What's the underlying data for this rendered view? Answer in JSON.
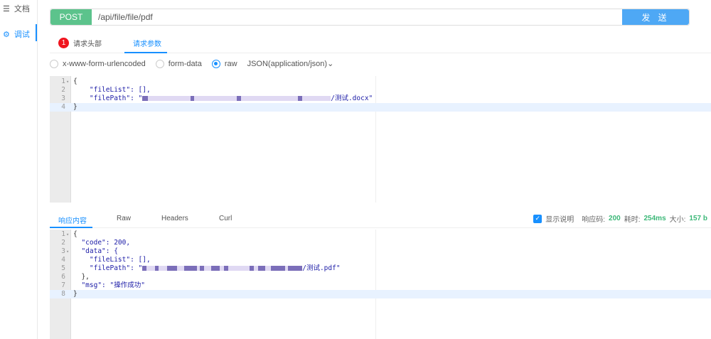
{
  "sidebar": {
    "items": [
      {
        "label": "文档",
        "icon": "doc-icon"
      },
      {
        "label": "调试",
        "icon": "debug-icon",
        "active": true
      }
    ]
  },
  "request": {
    "method": "POST",
    "url": "/api/file/file/pdf",
    "send_label": "发 送"
  },
  "tabs": [
    {
      "label": "请求头部",
      "badge": "1"
    },
    {
      "label": "请求参数",
      "active": true
    }
  ],
  "body_types": {
    "options": [
      "x-www-form-urlencoded",
      "form-data",
      "raw"
    ],
    "selected": "raw",
    "raw_format": "JSON(application/json)"
  },
  "request_body": {
    "lines": [
      "{",
      "    \"fileList\": [],",
      "    \"filePath\": \"",
      "}"
    ],
    "filepath_suffix": "/测试.docx\""
  },
  "response_tabs": [
    {
      "label": "响应内容",
      "active": true
    },
    {
      "label": "Raw"
    },
    {
      "label": "Headers"
    },
    {
      "label": "Curl"
    }
  ],
  "response_meta": {
    "show_desc_label": "显示说明",
    "show_desc_checked": true,
    "code_label": "响应码:",
    "code": "200",
    "time_label": "耗时:",
    "time": "254ms",
    "size_label": "大小:",
    "size": "157 b"
  },
  "response_body": {
    "lines": [
      "{",
      "  \"code\": 200,",
      "  \"data\": {",
      "    \"fileList\": [],",
      "    \"filePath\": \"",
      "  },",
      "  \"msg\": \"操作成功\"",
      "}"
    ],
    "filepath_suffix": "/测试.pdf\""
  },
  "colors": {
    "accent": "#1890ff",
    "post": "#5cc38c",
    "send": "#4ea8f5",
    "success": "#3cb878"
  }
}
